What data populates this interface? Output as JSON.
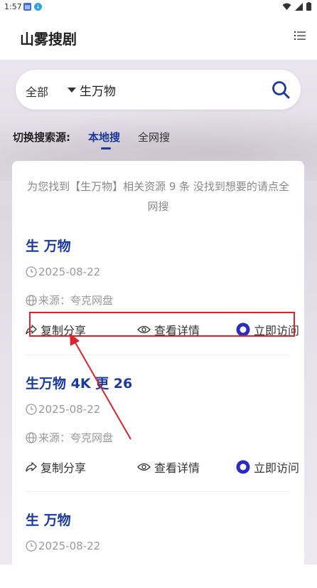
{
  "status_bar": {
    "time": "1:57"
  },
  "header": {
    "title": "山雾搜剧"
  },
  "search": {
    "scope": "全部",
    "query": "生万物"
  },
  "source_switch": {
    "label": "切换搜索源:",
    "tabs": [
      {
        "label": "本地搜",
        "active": true
      },
      {
        "label": "全网搜",
        "active": false
      }
    ]
  },
  "notice": "为您找到【生万物】相关资源 9 条 没找到想要的请点全网搜",
  "results": [
    {
      "title": "生 万物",
      "date": "2025-08-22",
      "source": "来源：夸克网盘"
    },
    {
      "title": "生万物 4K 更 26",
      "date": "2025-08-22",
      "source": "来源：夸克网盘"
    },
    {
      "title": "生 万物",
      "date": "2025-08-22"
    }
  ],
  "actions": {
    "share": "复制分享",
    "details": "查看详情",
    "visit": "立即访问"
  },
  "colors": {
    "accent": "#1a3a9c",
    "annotation": "#d9232d"
  }
}
